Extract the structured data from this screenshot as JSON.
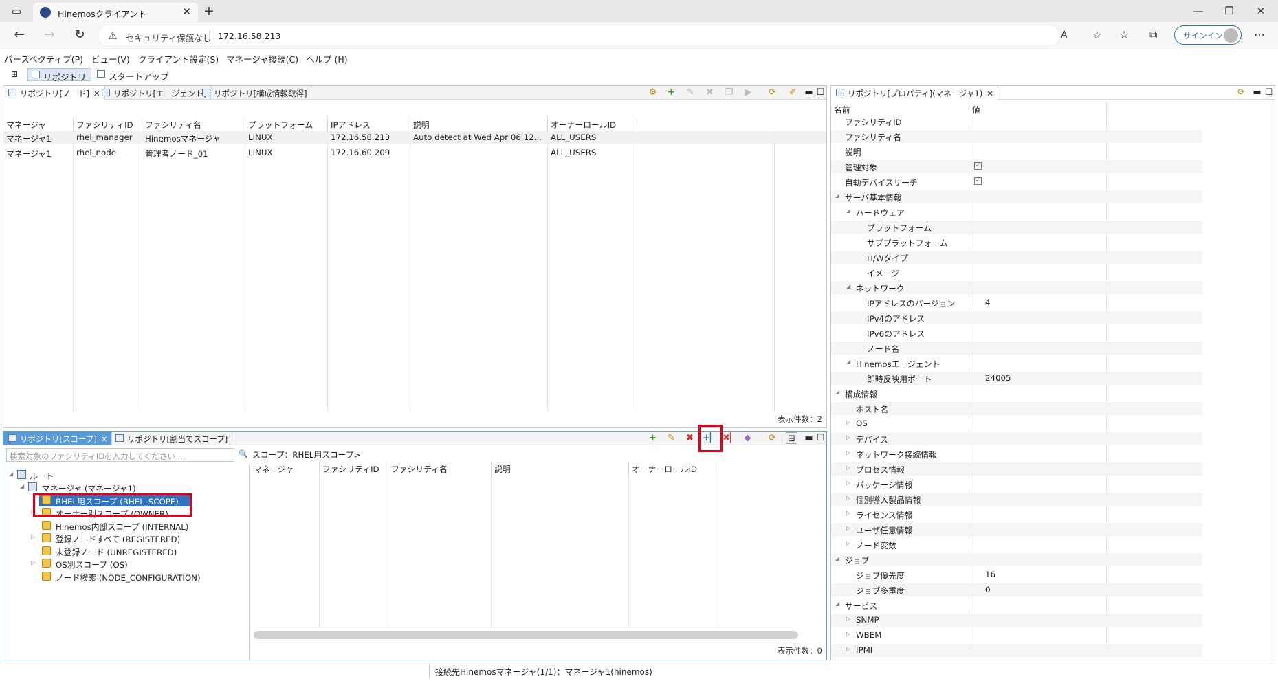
{
  "browser": {
    "tab_title": "Hinemosクライアント",
    "security_label": "セキュリティ保護なし",
    "url": "172.16.58.213",
    "signin_label": "サインイン"
  },
  "menu": [
    "パースペクティブ(P)",
    "ビュー(V)",
    "クライアント設定(S)",
    "マネージャ接続(C)",
    "ヘルプ (H)"
  ],
  "perspectives": [
    "リポジトリ",
    "スタートアップ"
  ],
  "node_view": {
    "tabs": [
      "リポジトリ[ノード]",
      "リポジトリ[エージェント]",
      "リポジトリ[構成情報取得]"
    ],
    "columns": [
      "マネージャ",
      "ファシリティID",
      "ファシリティ名",
      "プラットフォーム",
      "IPアドレス",
      "説明",
      "オーナーロールID"
    ],
    "rows": [
      [
        "マネージャ1",
        "rhel_manager",
        "Hinemosマネージャ",
        "LINUX",
        "172.16.58.213",
        "Auto detect at Wed Apr 06 12...",
        "ALL_USERS"
      ],
      [
        "マネージャ1",
        "rhel_node",
        "管理者ノード_01",
        "LINUX",
        "172.16.60.209",
        "",
        "ALL_USERS"
      ]
    ],
    "count": "表示件数：2"
  },
  "scope_view": {
    "tabs": [
      "リポジトリ[スコープ]",
      "リポジトリ[割当てスコープ]"
    ],
    "search_placeholder": "検索対象のファシリティIDを入力してください ...",
    "scope_label": "スコープ：RHEL用スコープ>",
    "tree": {
      "root": "ルート",
      "manager": "マネージャ (マネージャ1)",
      "items": [
        "RHEL用スコープ (RHEL_SCOPE)",
        "オーナー別スコープ (OWNER)",
        "Hinemos内部スコープ (INTERNAL)",
        "登録ノードすべて (REGISTERED)",
        "未登録ノード (UNREGISTERED)",
        "OS別スコープ (OS)",
        "ノード検索 (NODE_CONFIGURATION)"
      ]
    },
    "columns": [
      "マネージャ",
      "ファシリティID",
      "ファシリティ名",
      "説明",
      "オーナーロールID"
    ],
    "count": "表示件数：0"
  },
  "property_view": {
    "tab": "リポジトリ[プロパティ](マネージャ1)",
    "col_name": "名前",
    "col_value": "値",
    "rows": [
      {
        "name": "ファシリティID",
        "value": ""
      },
      {
        "name": "ファシリティ名",
        "value": ""
      },
      {
        "name": "説明",
        "value": ""
      },
      {
        "name": "管理対象",
        "value": "",
        "checked": true
      },
      {
        "name": "自動デバイスサーチ",
        "value": "",
        "checked": true
      },
      {
        "name": "サーバ基本情報",
        "value": ""
      },
      {
        "name": "ハードウェア",
        "value": ""
      },
      {
        "name": "プラットフォーム",
        "value": ""
      },
      {
        "name": "サブプラットフォーム",
        "value": ""
      },
      {
        "name": "H/Wタイプ",
        "value": ""
      },
      {
        "name": "イメージ",
        "value": ""
      },
      {
        "name": "ネットワーク",
        "value": ""
      },
      {
        "name": "IPアドレスのバージョン",
        "value": "4"
      },
      {
        "name": "IPv4のアドレス",
        "value": ""
      },
      {
        "name": "IPv6のアドレス",
        "value": ""
      },
      {
        "name": "ノード名",
        "value": ""
      },
      {
        "name": "Hinemosエージェント",
        "value": ""
      },
      {
        "name": "即時反映用ポート",
        "value": "24005"
      },
      {
        "name": "構成情報",
        "value": ""
      },
      {
        "name": "ホスト名",
        "value": ""
      },
      {
        "name": "OS",
        "value": ""
      },
      {
        "name": "デバイス",
        "value": ""
      },
      {
        "name": "ネットワーク接続情報",
        "value": ""
      },
      {
        "name": "プロセス情報",
        "value": ""
      },
      {
        "name": "パッケージ情報",
        "value": ""
      },
      {
        "name": "個別導入製品情報",
        "value": ""
      },
      {
        "name": "ライセンス情報",
        "value": ""
      },
      {
        "name": "ユーザ任意情報",
        "value": ""
      },
      {
        "name": "ノード変数",
        "value": ""
      },
      {
        "name": "ジョブ",
        "value": ""
      },
      {
        "name": "ジョブ優先度",
        "value": "16"
      },
      {
        "name": "ジョブ多重度",
        "value": "0"
      },
      {
        "name": "サービス",
        "value": ""
      },
      {
        "name": "SNMP",
        "value": ""
      },
      {
        "name": "WBEM",
        "value": ""
      },
      {
        "name": "IPMI",
        "value": ""
      }
    ]
  },
  "status": "接続先Hinemosマネージャ(1/1)：マネージャ1(hinemos)"
}
